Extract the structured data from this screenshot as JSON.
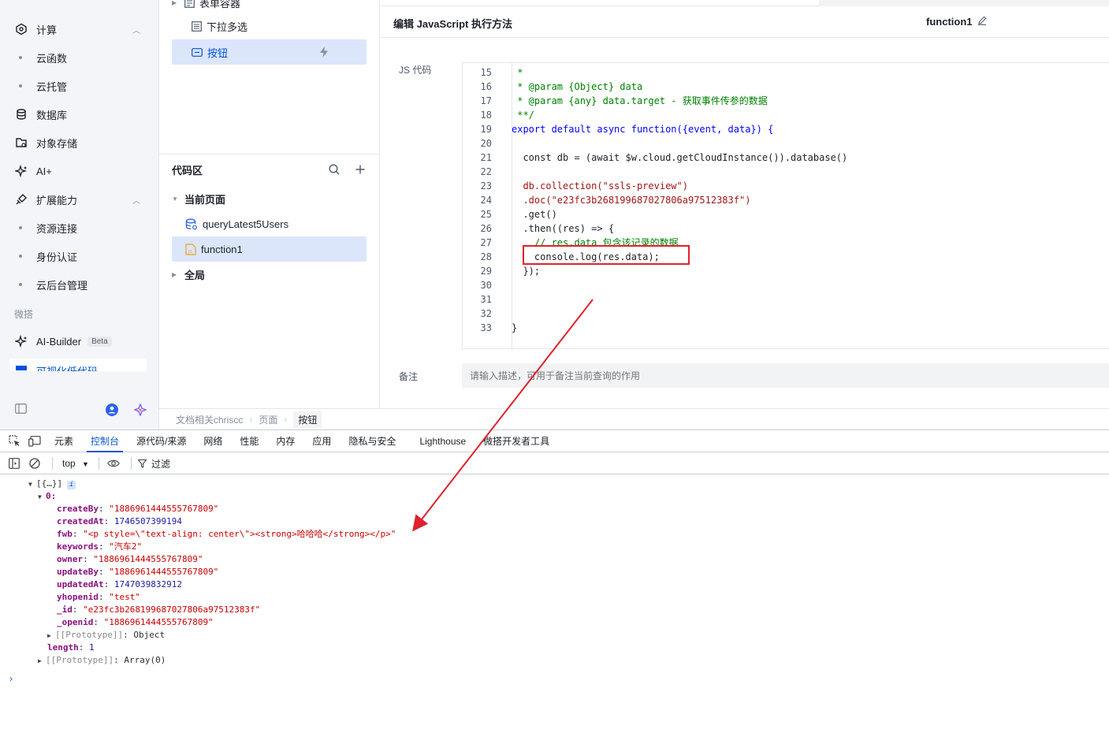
{
  "leftnav": {
    "items": [
      {
        "label": "计算",
        "icon": "cpu-icon",
        "expanded": true
      },
      {
        "label": "云函数",
        "sub": true
      },
      {
        "label": "云托管",
        "sub": true
      },
      {
        "label": "数据库",
        "icon": "database-icon"
      },
      {
        "label": "对象存储",
        "icon": "storage-icon"
      },
      {
        "label": "AI+",
        "icon": "sparkle-icon"
      },
      {
        "label": "扩展能力",
        "icon": "plug-icon",
        "expanded": true
      },
      {
        "label": "资源连接",
        "sub": true
      },
      {
        "label": "身份认证",
        "sub": true
      },
      {
        "label": "云后台管理",
        "sub": true
      }
    ],
    "group_label": "微搭",
    "ai_builder": {
      "label": "AI-Builder",
      "badge": "Beta"
    },
    "lowcode_label": "可视化低代码"
  },
  "midpanel": {
    "components": [
      {
        "label": "表单容器"
      },
      {
        "label": "下拉多选"
      },
      {
        "label": "按钮",
        "selected": true
      }
    ],
    "code_section": {
      "title": "代码区",
      "current_page": "当前页面",
      "items": [
        {
          "label": "queryLatest5Users"
        },
        {
          "label": "function1",
          "selected": true
        }
      ],
      "global": "全局"
    }
  },
  "editor": {
    "title": "编辑 JavaScript 执行方法",
    "function_name": "function1",
    "js_label": "JS 代码",
    "note_label": "备注",
    "note_placeholder": "请输入描述，可用于备注当前查询的作用",
    "lines": [
      {
        "n": "15",
        "t": " *"
      },
      {
        "n": "16",
        "t": " * @param {Object} data"
      },
      {
        "n": "17",
        "t": " * @param {any} data.target - 获取事件传参的数据"
      },
      {
        "n": "18",
        "t": " **/"
      },
      {
        "n": "19",
        "t": "export default async function({event, data}) {"
      },
      {
        "n": "20",
        "t": ""
      },
      {
        "n": "21",
        "t": "  const db = (await $w.cloud.getCloudInstance()).database()"
      },
      {
        "n": "22",
        "t": ""
      },
      {
        "n": "23",
        "t": "  db.collection(\"ssls-preview\")"
      },
      {
        "n": "24",
        "t": "  .doc(\"e23fc3b268199687027806a97512383f\")"
      },
      {
        "n": "25",
        "t": "  .get()"
      },
      {
        "n": "26",
        "t": "  .then((res) => {"
      },
      {
        "n": "27",
        "t": "    // res.data 包含该记录的数据"
      },
      {
        "n": "28",
        "t": "    console.log(res.data);"
      },
      {
        "n": "29",
        "t": "  });"
      },
      {
        "n": "30",
        "t": ""
      },
      {
        "n": "31",
        "t": ""
      },
      {
        "n": "32",
        "t": ""
      },
      {
        "n": "33",
        "t": "}"
      }
    ]
  },
  "breadcrumb": [
    "文档相关chriscc",
    "页面",
    "按钮"
  ],
  "devtools": {
    "tabs": [
      "元素",
      "控制台",
      "源代码/来源",
      "网络",
      "性能",
      "内存",
      "应用",
      "隐私与安全",
      "Lighthouse",
      "微搭开发者工具"
    ],
    "active_tab": "控制台",
    "context": "top",
    "filter_label": "过滤",
    "console": {
      "root": "[{…}]",
      "index": "0:",
      "fields": [
        {
          "key": "createBy",
          "value": "\"1886961444555767809\"",
          "type": "s"
        },
        {
          "key": "createdAt",
          "value": "1746507399194",
          "type": "n"
        },
        {
          "key": "fwb",
          "value": "\"<p style=\\\"text-align: center\\\"><strong>哈哈哈</strong></p>\"",
          "type": "s"
        },
        {
          "key": "keywords",
          "value": "\"汽车2\"",
          "type": "s"
        },
        {
          "key": "owner",
          "value": "\"1886961444555767809\"",
          "type": "s"
        },
        {
          "key": "updateBy",
          "value": "\"1886961444555767809\"",
          "type": "s"
        },
        {
          "key": "updatedAt",
          "value": "1747039832912",
          "type": "n"
        },
        {
          "key": "yhopenid",
          "value": "\"test\"",
          "type": "s"
        },
        {
          "key": "_id",
          "value": "\"e23fc3b268199687027806a97512383f\"",
          "type": "s"
        },
        {
          "key": "_openid",
          "value": "\"1886961444555767809\"",
          "type": "s"
        }
      ],
      "proto_obj_key": "[[Prototype]]",
      "proto_obj_val": "Object",
      "length_key": "length",
      "length_val": "1",
      "proto_arr_key": "[[Prototype]]",
      "proto_arr_val": "Array(0)",
      "prompt": "›"
    }
  },
  "colors": {
    "accent": "#0052d9",
    "highlight": "#e0212e",
    "selected_bg": "#dbe6fb"
  }
}
